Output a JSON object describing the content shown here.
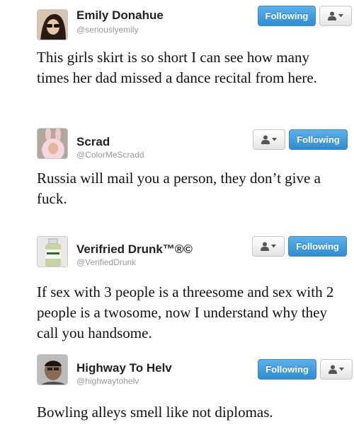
{
  "accent_color": "#2f8dd3",
  "tweets": [
    {
      "name": "Emily Donahue",
      "handle": "@seriouslyemily",
      "text": "This girls skirt is so short I can see how many times her dad missed a dance recital from here.",
      "follow_label": "Following"
    },
    {
      "name": "Scrad",
      "handle": "@ColorMeScradd",
      "text": "Russia will mail you a person, they don’t give a fuck.",
      "follow_label": "Following"
    },
    {
      "name": "Verifried Drunk™®©",
      "handle": "@VerifiedDrunk",
      "text": "If sex with 3 people is a threesome and sex with 2 people is a twosome, now I understand why they call you handsome.",
      "follow_label": "Following"
    },
    {
      "name": "Highway To Helv",
      "handle": "@highwaytohelv",
      "text": "Bowling alleys smell like not diplomas.",
      "follow_label": "Following"
    }
  ]
}
